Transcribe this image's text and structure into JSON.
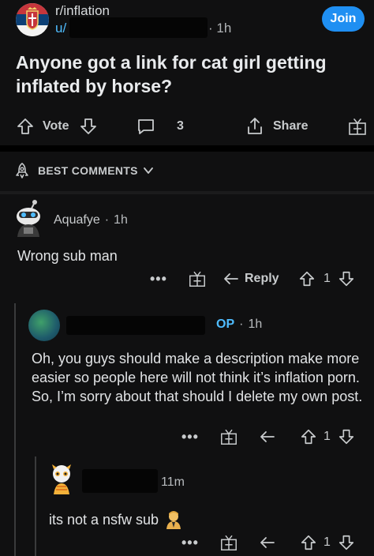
{
  "post": {
    "subreddit": "r/inflation",
    "user_prefix": "u/",
    "time": "1h",
    "join_label": "Join",
    "title": "Anyone got a link for cat girl getting inflated by horse?",
    "vote_label": "Vote",
    "comment_count": "3",
    "share_label": "Share"
  },
  "sort": {
    "label": "BEST COMMENTS"
  },
  "comments": [
    {
      "author": "Aquafye",
      "time": "1h",
      "text": "Wrong sub man",
      "more_label": "•••",
      "reply_label": "Reply",
      "score": "1"
    },
    {
      "badge": "OP",
      "time": "1h",
      "text": "Oh, you guys should make a description make more easier so people here will not think it’s inflation porn. So, I’m sorry about that should I delete my own post.",
      "more_label": "•••",
      "score": "1"
    },
    {
      "time": "11m",
      "text": "its not a nsfw sub",
      "more_label": "•••",
      "score": "1"
    }
  ],
  "colors": {
    "accent": "#1f8ff2",
    "link": "#4fbcff",
    "background": "#101011"
  },
  "icons": [
    "upvote-icon",
    "downvote-icon",
    "comment-icon",
    "share-icon",
    "award-icon",
    "best-comments-icon",
    "reply-icon"
  ]
}
